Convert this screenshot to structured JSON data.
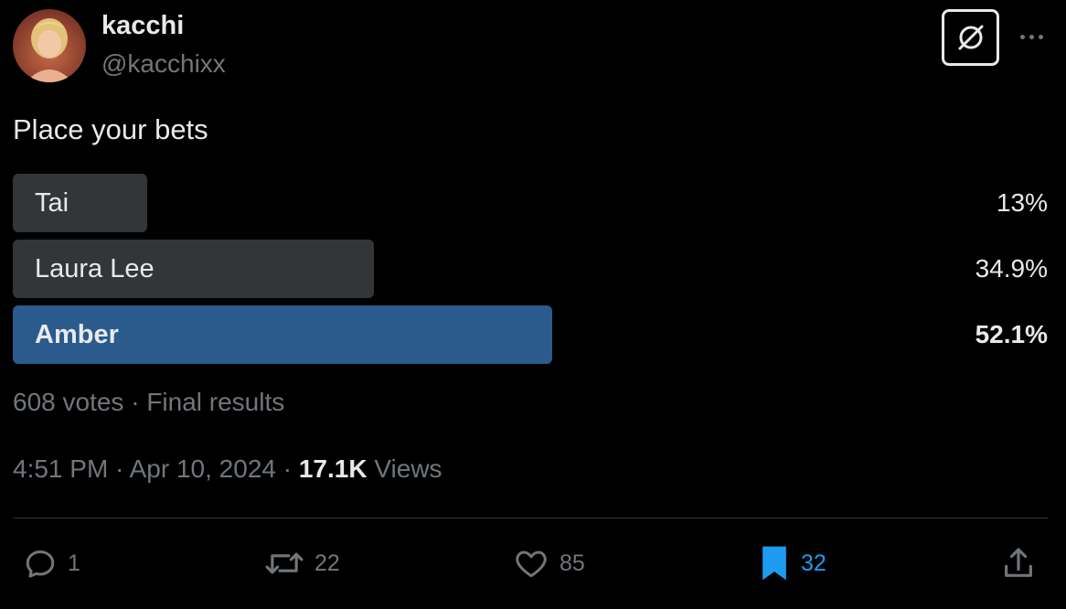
{
  "author": {
    "display_name": "kacchi",
    "handle": "@kacchixx",
    "avatar": "profile-photo"
  },
  "tweet": {
    "text": "Place your bets"
  },
  "poll": {
    "options": [
      {
        "label": "Tai",
        "percent": "13%",
        "share": 13.0,
        "winner": false
      },
      {
        "label": "Laura Lee",
        "percent": "34.9%",
        "share": 34.9,
        "winner": false
      },
      {
        "label": "Amber",
        "percent": "52.1%",
        "share": 52.1,
        "winner": true
      }
    ],
    "votes": "608 votes",
    "status": "Final results",
    "separator": " · "
  },
  "meta": {
    "time": "4:51 PM",
    "date": "Apr 10, 2024",
    "views_count": "17.1K",
    "views_label": "Views"
  },
  "actions": {
    "replies": "1",
    "reposts": "22",
    "likes": "85",
    "bookmarks": "32"
  },
  "icons": {
    "grok": "grok-icon",
    "more": "more-icon",
    "reply": "reply-icon",
    "repost": "repost-icon",
    "like": "heart-icon",
    "bookmark": "bookmark-icon",
    "share": "share-icon"
  },
  "colors": {
    "background": "#000000",
    "winner_bar": "#2b5a8c",
    "other_bar": "#333639",
    "secondary_text": "#71767b",
    "accent": "#1d9bf0"
  }
}
